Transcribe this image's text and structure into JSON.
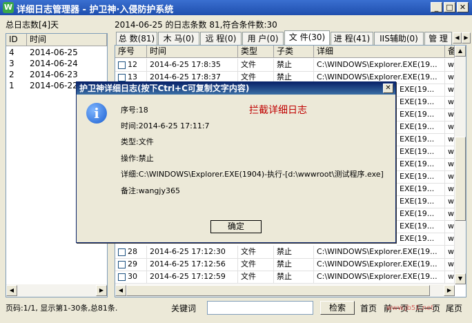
{
  "window": {
    "icon_letter": "W",
    "title": "详细日志管理器 - 护卫神·入侵防护系统",
    "min": "_",
    "max": "□",
    "close": "✕"
  },
  "left": {
    "summary": "总日志数[4]天",
    "headers": {
      "id": "ID",
      "time": "时间"
    },
    "rows": [
      {
        "id": "4",
        "time": "2014-06-25"
      },
      {
        "id": "3",
        "time": "2014-06-24"
      },
      {
        "id": "2",
        "time": "2014-06-23"
      },
      {
        "id": "1",
        "time": "2014-06-22"
      }
    ]
  },
  "right": {
    "summary": "2014-06-25 的日志条数 81,符合条件数:30",
    "tabs": [
      {
        "label": "总 数(81)"
      },
      {
        "label": "木 马(0)"
      },
      {
        "label": "远 程(0)"
      },
      {
        "label": "用 户(0)"
      },
      {
        "label": "文 件(30)"
      },
      {
        "label": "进 程(41)"
      },
      {
        "label": "IIS辅助(0)"
      },
      {
        "label": "管 理"
      }
    ],
    "headers": {
      "seq": "序号",
      "time": "时间",
      "type": "类型",
      "sub": "子类",
      "detail": "详细",
      "note": "备"
    },
    "rows_top": [
      {
        "seq": "12",
        "time": "2014-6-25 17:8:35",
        "type": "文件",
        "sub": "禁止",
        "detail": "C:\\WINDOWS\\Explorer.EXE(19...",
        "note": "w"
      },
      {
        "seq": "13",
        "time": "2014-6-25 17:8:37",
        "type": "文件",
        "sub": "禁止",
        "detail": "C:\\WINDOWS\\Explorer.EXE(19...",
        "note": "w"
      }
    ],
    "rows_mid_details": [
      "EXE(19...",
      "EXE(19...",
      "EXE(19...",
      "EXE(19...",
      "EXE(19...",
      "EXE(19...",
      "EXE(19...",
      "EXE(19...",
      "EXE(19...",
      "EXE(19...",
      "EXE(19...",
      "EXE(19...",
      "EXE(19..."
    ],
    "rows_mid_note": "w",
    "rows_bottom": [
      {
        "seq": "28",
        "time": "2014-6-25 17:12:30",
        "type": "文件",
        "sub": "禁止",
        "detail": "C:\\WINDOWS\\Explorer.EXE(19...",
        "note": "w"
      },
      {
        "seq": "29",
        "time": "2014-6-25 17:12:56",
        "type": "文件",
        "sub": "禁止",
        "detail": "C:\\WINDOWS\\Explorer.EXE(19...",
        "note": "w"
      },
      {
        "seq": "30",
        "time": "2014-6-25 17:12:59",
        "type": "文件",
        "sub": "禁止",
        "detail": "C:\\WINDOWS\\Explorer.EXE(19...",
        "note": "w"
      }
    ]
  },
  "dialog": {
    "title": "护卫神详细日志(按下Ctrl+C可复制文字内容)",
    "close": "✕",
    "icon": "i",
    "heading": "拦截详细日志",
    "seq": "序号:18",
    "time": "时间:2014-6-25 17:11:7",
    "type": "类型:文件",
    "action": "操作:禁止",
    "detail": "详细:C:\\WINDOWS\\Explorer.EXE(1904)-执行-[d:\\wwwroot\\测试程序.exe]",
    "note": "备注:wangjy365",
    "ok": "确定"
  },
  "footer": {
    "page_info": "页码:1/1, 显示第1-30条,总81条.",
    "keyword_label": "关键词",
    "keyword_value": "",
    "search": "检索",
    "first": "首页",
    "prev": "前一页",
    "next": "后一页",
    "last": "尾页",
    "watermark": "www.jb51.net"
  },
  "colors": {
    "accent_red": "#c00000",
    "title_blue": "#1f4fae"
  }
}
